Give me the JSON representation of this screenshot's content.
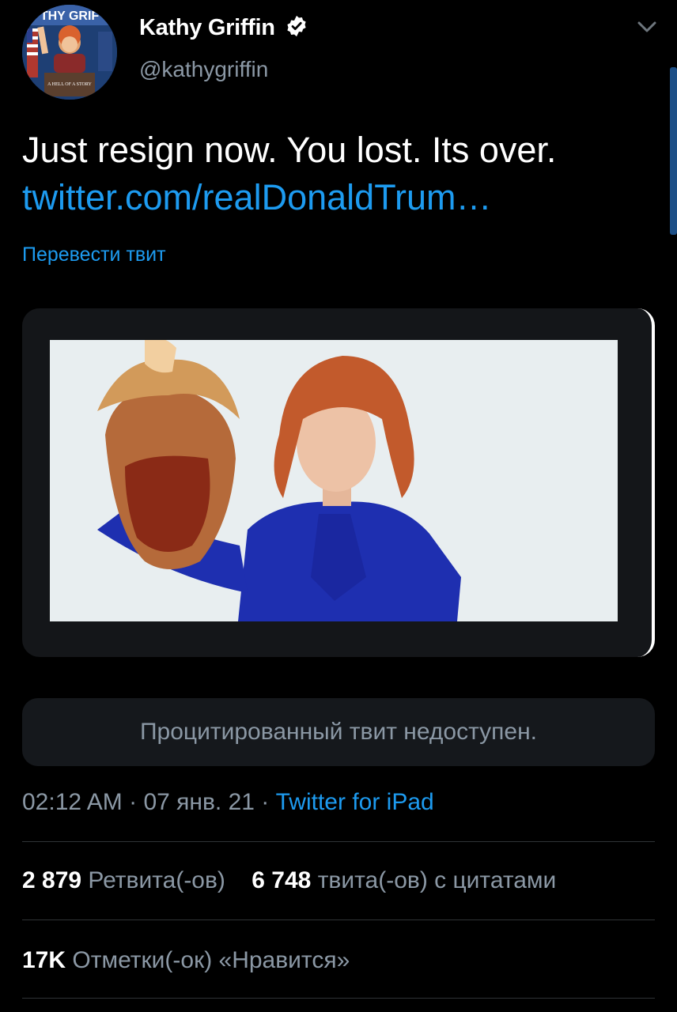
{
  "author": {
    "name": "Kathy Griffin",
    "handle": "@kathygriffin",
    "verified": true,
    "avatar_banner_text": "THY GRIF",
    "avatar_caption": "A HELL OF A STORY"
  },
  "tweet": {
    "text": "Just resign now. You lost. Its over.",
    "link": "twitter.com/realDonaldTrum…",
    "translate_label": "Перевести твит"
  },
  "quoted": {
    "unavailable_text": "Процитированный твит недоступен."
  },
  "meta": {
    "time": "02:12 AM",
    "date": "07 янв. 21",
    "separator": "·",
    "source": "Twitter for iPad"
  },
  "stats": {
    "retweets_count": "2 879",
    "retweets_label": "Ретвита(-ов)",
    "quotes_count": "6 748",
    "quotes_label": "твита(-ов) с цитатами",
    "likes_count": "17K",
    "likes_label": "Отметки(-ок) «Нравится»"
  },
  "colors": {
    "background": "#000000",
    "link": "#1d9bf0",
    "secondary_text": "#8b98a5",
    "card": "#141619"
  },
  "icons": {
    "verified": "verified-badge-icon",
    "more": "chevron-down-icon"
  }
}
